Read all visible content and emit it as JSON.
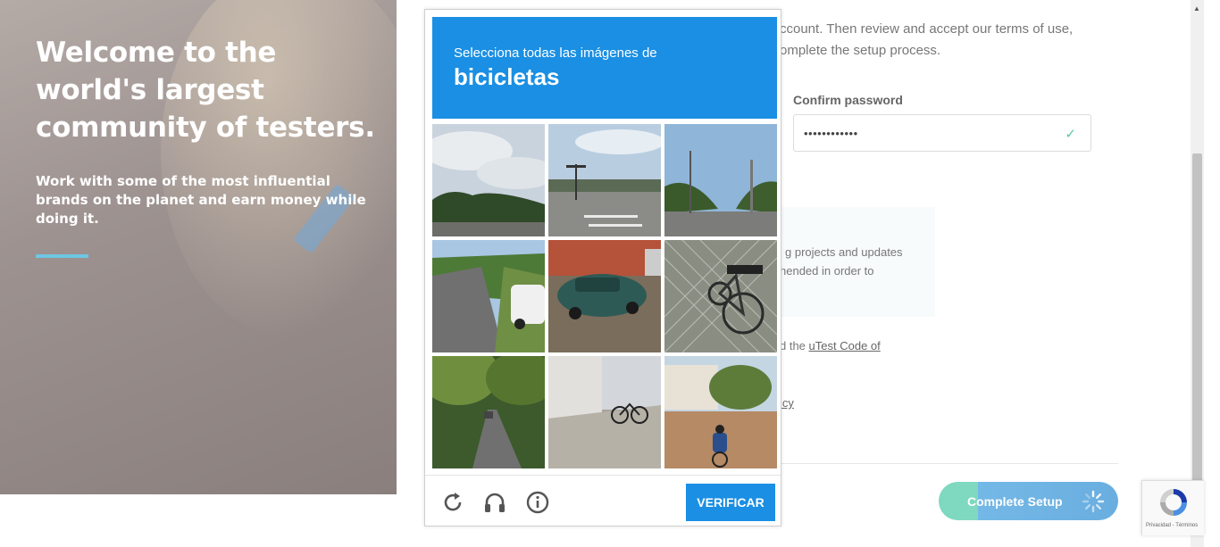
{
  "hero": {
    "title": "Welcome to the world's largest community of testers.",
    "subtitle": "Work with some of the most influential brands on the planet and earn money while doing it."
  },
  "form": {
    "intro_line1": "ccount. Then review and accept our terms of use,",
    "intro_line2": "omplete the setup process.",
    "confirm_password_label": "Confirm password",
    "confirm_password_value": "••••••••••••",
    "notice_line1": "g projects and updates",
    "notice_line2": "hended in order to",
    "code_prefix": "d the ",
    "code_link": "uTest Code of",
    "policy_fragment": "icy",
    "complete_button": "Complete Setup"
  },
  "captcha": {
    "instruction": "Selecciona todas las imágenes de",
    "object": "bicicletas",
    "verify_button": "VERIFICAR",
    "tiles": [
      "street-clouds",
      "intersection",
      "road-poles",
      "road-white-suv",
      "parked-green-car",
      "bicycle-fence",
      "tree-lined-street",
      "sidewalk-bicycle",
      "cyclist-street"
    ]
  },
  "recaptcha_badge": {
    "terms": "Privacidad - Términos"
  },
  "colors": {
    "captcha_blue": "#1a8fe3",
    "accent_teal": "#7fd8c0",
    "accent_blue": "#6aaee0",
    "hero_accent": "#6ec6e3"
  }
}
